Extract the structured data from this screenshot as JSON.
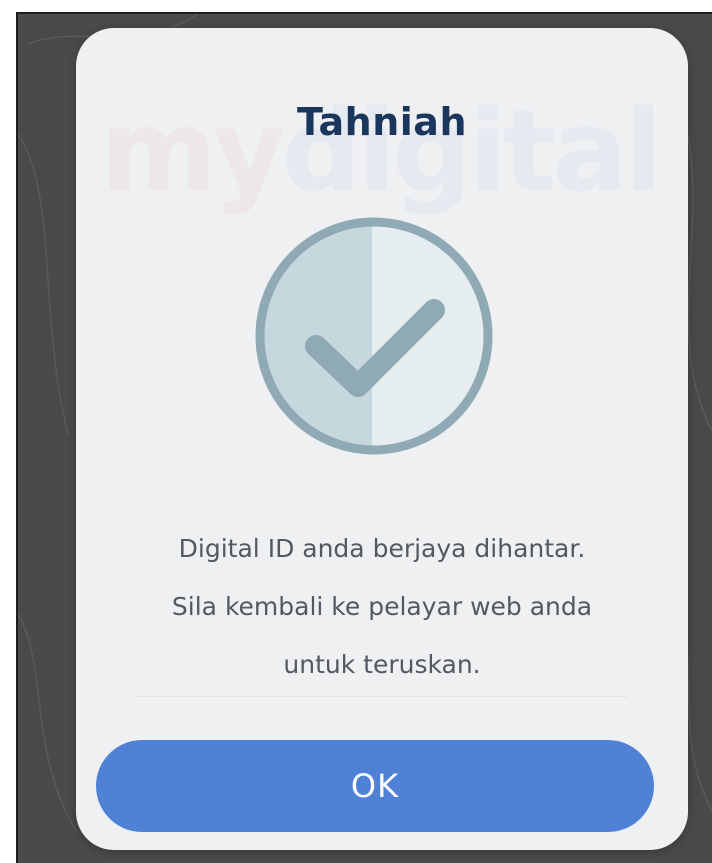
{
  "dialog": {
    "watermark": [
      "my",
      "digital ID"
    ],
    "title": "Tahniah",
    "icon": "check-circle-icon",
    "message_lines": [
      "Digital ID anda berjaya dihantar.",
      "Sila kembali ke pelayar web anda",
      "untuk teruskan."
    ],
    "ok_label": "OK"
  },
  "colors": {
    "overlay": "#4a4a4a",
    "dialog_bg": "#eef0f2",
    "title": "#1b365d",
    "message": "#545860",
    "icon_ring": "#8faab4",
    "icon_fill_left": "#c7d7de",
    "icon_fill_right": "#e6edf0",
    "button": "#4f81d7",
    "button_text": "#ffffff"
  }
}
